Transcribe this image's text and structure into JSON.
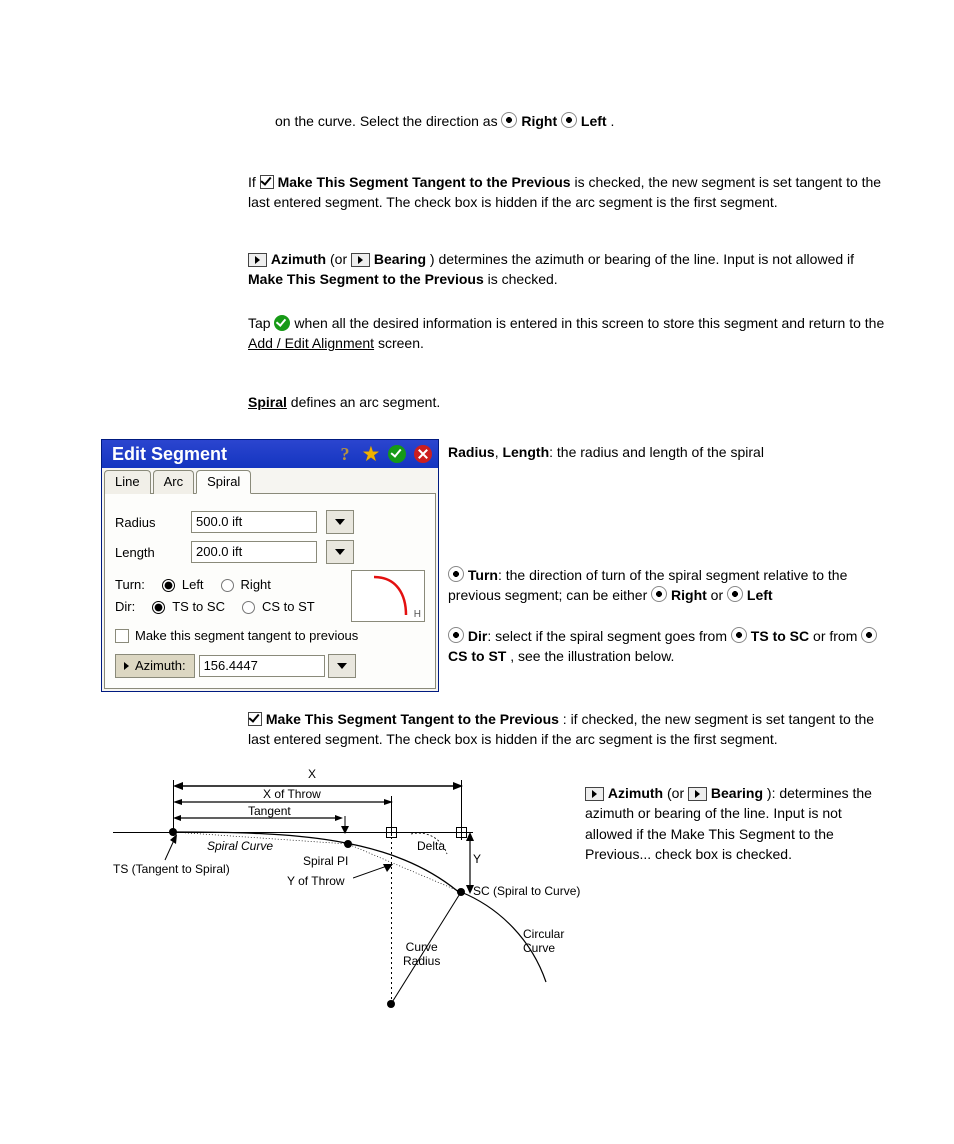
{
  "p1": {
    "pre": " on the curve. Select the direction as ",
    "b1": "Right",
    "inl": " ",
    "b2": "Left",
    "post": "."
  },
  "p2": {
    "pre": "If ",
    "label": "Make This Segment Tangent to the Previous",
    "post": " is checked, the new segment is set tangent to the last entered segment. The check box is hidden if the arc segment is the first segment."
  },
  "p3": {
    "b1": "Azimuth",
    "mid": " (or ",
    "b2": "Bearing",
    "post1": ") determines the azimuth or bearing of the line. Input is not allowed if ",
    "b3": "Make This Segment to the Previous",
    "post2": " is checked."
  },
  "p4": {
    "pre": "Tap ",
    "post": " when all the desired information is entered in this screen to store this segment and return to the ",
    "link": "Add / Edit Alignment",
    "post2": " screen."
  },
  "h_spiral": "Spiral",
  "d_spiral": " defines an arc segment.",
  "dlg": {
    "title": "Edit Segment",
    "tabs": {
      "line": "Line",
      "arc": "Arc",
      "spiral": "Spiral"
    },
    "radius_label": "Radius",
    "radius_value": "500.0 ift",
    "length_label": "Length",
    "length_value": "200.0 ift",
    "turn_label": "Turn:",
    "left": "Left",
    "right": "Right",
    "dir_label": "Dir:",
    "dir_a": "TS to SC",
    "dir_b": "CS to ST",
    "make_tangent": "Make this segment tangent to previous",
    "az_label": "Azimuth:",
    "az_value": "156.4447",
    "thumb_label": "H"
  },
  "diagram": {
    "x": "X",
    "x_throw": "X of Throw",
    "tangent": "Tangent",
    "spiral_curve": "Spiral Curve",
    "spiral_pi": "Spiral PI",
    "ts": "TS (Tangent to Spiral)",
    "y_throw": "Y of Throw",
    "sc": "SC (Spiral to Curve)",
    "curve_radius": "Curve\nRadius",
    "circ_curve": "Circular\nCurve",
    "delta": "Delta",
    "y": "Y"
  },
  "r_radius": {
    "b": "Radius",
    "post": ", ",
    "b2": "Length",
    "post2": ": the radius and length of the spiral"
  },
  "r_turn": {
    "b": "Turn",
    "post": ": the direction of turn of the spiral segment relative to the previous segment; can be either ",
    "b2": "Right",
    "or": " or ",
    "b3": "Left"
  },
  "r_dir": {
    "b": "Dir",
    "post": ": select if the spiral segment goes from ",
    "b2": "TS to SC",
    "or": " or from ",
    "b3": "CS to ST",
    "post2": ", see the illustration below."
  },
  "r_make": {
    "b": "Make This Segment Tangent to the Previous",
    "post": ": if checked, the new segment is set tangent to the last entered segment. The check box is hidden if the arc segment is the first segment."
  },
  "r_az": {
    "b": "Azimuth",
    "mid": " (or ",
    "b2": "Bearing",
    "post": "): determines the azimuth or bearing of the line. Input is not allowed if the Make This Segment to the Previous... check box is checked."
  }
}
